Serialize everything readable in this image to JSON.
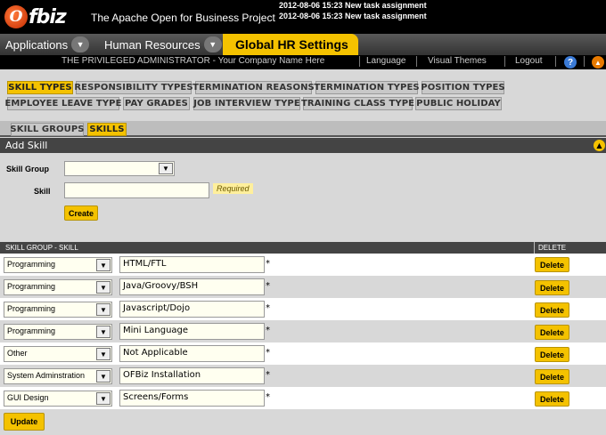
{
  "header": {
    "logo_text": "Ofbiz",
    "tagline": "The Apache Open for Business Project",
    "notices": [
      "2012-08-06 15:23 New task assignment",
      "2012-08-06 15:23 New task assignment"
    ]
  },
  "appbar": {
    "applications_label": "Applications",
    "human_resources_label": "Human Resources",
    "current_app_label": "Global HR Settings"
  },
  "userbar": {
    "user_text": "THE PRIVILEGED ADMINISTRATOR - Your Company Name Here",
    "language_label": "Language",
    "themes_label": "Visual Themes",
    "logout_label": "Logout"
  },
  "tabs_row1": [
    "SKILL TYPES",
    "RESPONSIBILITY TYPES",
    "TERMINATION REASONS",
    "TERMINATION TYPES",
    "POSITION TYPES"
  ],
  "tabs_row2": [
    "EMPLOYEE LEAVE TYPE",
    "PAY GRADES",
    "JOB INTERVIEW TYPE",
    "TRAINING CLASS TYPE",
    "PUBLIC HOLIDAY"
  ],
  "subtabs": [
    "SKILL GROUPS",
    "SKILLS"
  ],
  "add_skill": {
    "title": "Add Skill",
    "skill_group_label": "Skill Group",
    "skill_group_value": "",
    "skill_label": "Skill",
    "skill_value": "",
    "required_label": "Required",
    "create_label": "Create"
  },
  "table": {
    "col_group_skill": "SKILL GROUP - SKILL",
    "col_delete": "DELETE",
    "required_mark": "*",
    "delete_label": "Delete",
    "rows": [
      {
        "group": "Programming",
        "skill": "HTML/FTL"
      },
      {
        "group": "Programming",
        "skill": "Java/Groovy/BSH"
      },
      {
        "group": "Programming",
        "skill": "Javascript/Dojo"
      },
      {
        "group": "Programming",
        "skill": "Mini Language"
      },
      {
        "group": "Other",
        "skill": "Not Applicable"
      },
      {
        "group": "System Adminstration",
        "skill": "OFBiz Installation"
      },
      {
        "group": "GUI Design",
        "skill": "Screens/Forms"
      }
    ],
    "update_label": "Update"
  },
  "colors": {
    "accent": "#f4c200",
    "header_bg": "#000000",
    "title_bg": "#444444"
  }
}
